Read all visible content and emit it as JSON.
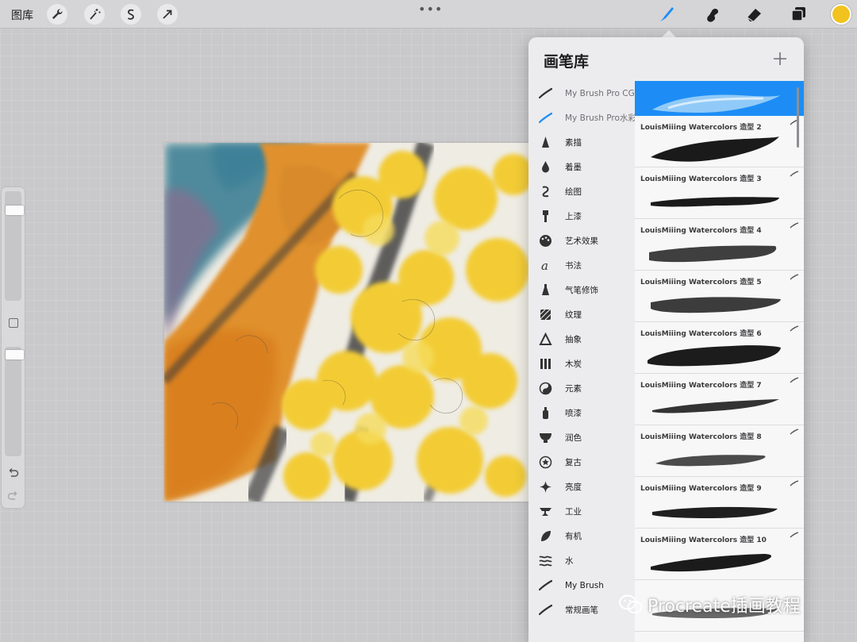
{
  "topbar": {
    "gallery_label": "图库",
    "tools_left": [
      "wrench-icon",
      "magic-wand-icon",
      "selection-icon",
      "transform-arrow-icon"
    ],
    "tools_right": [
      "brush-icon",
      "smudge-icon",
      "eraser-icon",
      "layers-icon"
    ],
    "active_tool": "brush",
    "color_swatch": "#f2c31e",
    "more_dots": "•••"
  },
  "sidebar": {
    "size_slider_level": 0.14,
    "opacity_slider_level": 0.03,
    "icons": [
      "modify-square-icon",
      "undo-icon",
      "redo-icon"
    ]
  },
  "panel": {
    "title": "画笔库",
    "add_icon": "plus-icon",
    "accent_color": "#1d8df5",
    "brush_sets": [
      {
        "label": "My Brush Pro CG",
        "icon": "brush-stroke-icon",
        "state": "muted"
      },
      {
        "label": "My Brush Pro水彩",
        "icon": "brush-stroke-blue-icon",
        "state": "selected"
      },
      {
        "label": "素描",
        "icon": "pencil-tip-icon",
        "state": "normal"
      },
      {
        "label": "着墨",
        "icon": "ink-drop-icon",
        "state": "normal"
      },
      {
        "label": "绘图",
        "icon": "swirl-icon",
        "state": "normal"
      },
      {
        "label": "上漆",
        "icon": "paint-brush-icon",
        "state": "normal"
      },
      {
        "label": "艺术效果",
        "icon": "palette-icon",
        "state": "normal"
      },
      {
        "label": "书法",
        "icon": "calligraphy-a-icon",
        "state": "normal"
      },
      {
        "label": "气笔修饰",
        "icon": "airbrush-icon",
        "state": "normal"
      },
      {
        "label": "纹理",
        "icon": "texture-icon",
        "state": "normal"
      },
      {
        "label": "抽象",
        "icon": "triangle-icon",
        "state": "normal"
      },
      {
        "label": "木炭",
        "icon": "charcoal-bars-icon",
        "state": "normal"
      },
      {
        "label": "元素",
        "icon": "yin-yang-icon",
        "state": "normal"
      },
      {
        "label": "喷漆",
        "icon": "spray-can-icon",
        "state": "normal"
      },
      {
        "label": "润色",
        "icon": "blender-icon",
        "state": "normal"
      },
      {
        "label": "复古",
        "icon": "star-badge-icon",
        "state": "normal"
      },
      {
        "label": "亮度",
        "icon": "sparkle-icon",
        "state": "normal"
      },
      {
        "label": "工业",
        "icon": "anvil-icon",
        "state": "normal"
      },
      {
        "label": "有机",
        "icon": "leaf-icon",
        "state": "normal"
      },
      {
        "label": "水",
        "icon": "waves-icon",
        "state": "normal"
      },
      {
        "label": "My Brush",
        "icon": "brush-stroke-icon",
        "state": "normal"
      },
      {
        "label": "常规画笔",
        "icon": "brush-stroke-icon",
        "state": "normal"
      }
    ],
    "brushes": [
      {
        "name": "",
        "selected": true
      },
      {
        "name": "LouisMiiing Watercolors 造型 2",
        "selected": false
      },
      {
        "name": "LouisMiiing Watercolors 造型 3",
        "selected": false
      },
      {
        "name": "LouisMiiing Watercolors 造型 4",
        "selected": false
      },
      {
        "name": "LouisMiiing Watercolors 造型 5",
        "selected": false
      },
      {
        "name": "LouisMiiing Watercolors 造型 6",
        "selected": false
      },
      {
        "name": "LouisMiiing Watercolors 造型 7",
        "selected": false
      },
      {
        "name": "LouisMiiing Watercolors 造型 8",
        "selected": false
      },
      {
        "name": "LouisMiiing Watercolors 造型 9",
        "selected": false
      },
      {
        "name": "LouisMiiing Watercolors 造型 10",
        "selected": false
      }
    ]
  },
  "watermark": {
    "text": "Procreate插画教程",
    "icon": "wechat-logo-icon"
  }
}
